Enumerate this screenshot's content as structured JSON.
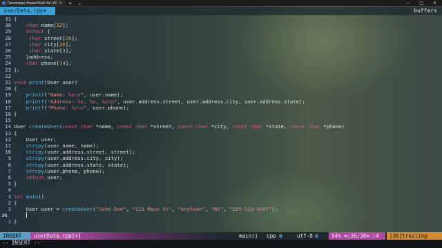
{
  "window": {
    "tab_title": "Developer PowerShell for VS",
    "new_tab": "+",
    "dropdown": "⌄",
    "controls": [
      "—",
      "□",
      "✕"
    ]
  },
  "tabline": {
    "active_buffer": "userData.cpp",
    "modified_marker": "+",
    "right_label": "buffers"
  },
  "editor": {
    "current_line": "36",
    "lines": [
      {
        "n": "31",
        "tokens": [
          [
            "id",
            "{"
          ]
        ]
      },
      {
        "n": "30",
        "tokens": [
          [
            "id",
            "    "
          ],
          [
            "ty",
            "char"
          ],
          [
            "id",
            " name["
          ],
          [
            "num",
            "32"
          ],
          [
            "id",
            "];"
          ]
        ]
      },
      {
        "n": "29",
        "tokens": [
          [
            "id",
            "    "
          ],
          [
            "ty",
            "struct"
          ],
          [
            "id",
            " {"
          ]
        ]
      },
      {
        "n": "28",
        "tokens": [
          [
            "id",
            "     "
          ],
          [
            "ty",
            "char"
          ],
          [
            "id",
            " street["
          ],
          [
            "num",
            "20"
          ],
          [
            "id",
            "];"
          ]
        ]
      },
      {
        "n": "27",
        "tokens": [
          [
            "id",
            "     "
          ],
          [
            "ty",
            "char"
          ],
          [
            "id",
            " city["
          ],
          [
            "num",
            "20"
          ],
          [
            "id",
            "];"
          ]
        ]
      },
      {
        "n": "26",
        "tokens": [
          [
            "id",
            "     "
          ],
          [
            "ty",
            "char"
          ],
          [
            "id",
            " state["
          ],
          [
            "num",
            "3"
          ],
          [
            "id",
            "];"
          ]
        ]
      },
      {
        "n": "25",
        "tokens": [
          [
            "id",
            "    }address;"
          ]
        ]
      },
      {
        "n": "24",
        "tokens": [
          [
            "id",
            "    "
          ],
          [
            "ty",
            "char"
          ],
          [
            "id",
            " phone["
          ],
          [
            "num",
            "14"
          ],
          [
            "id",
            "];"
          ]
        ]
      },
      {
        "n": "23",
        "tokens": [
          [
            "id",
            "};"
          ]
        ]
      },
      {
        "n": "22",
        "tokens": []
      },
      {
        "n": "21",
        "tokens": [
          [
            "ty",
            "void"
          ],
          [
            "id",
            " "
          ],
          [
            "fn",
            "print"
          ],
          [
            "id",
            "(User user)"
          ]
        ]
      },
      {
        "n": "20",
        "tokens": [
          [
            "id",
            "{"
          ]
        ]
      },
      {
        "n": "19",
        "tokens": [
          [
            "id",
            "    "
          ],
          [
            "fn",
            "printf"
          ],
          [
            "id",
            "("
          ],
          [
            "str",
            "\"Name: "
          ],
          [
            "kw",
            "%s\\n"
          ],
          [
            "str",
            "\""
          ],
          [
            "id",
            ", user.name);"
          ]
        ]
      },
      {
        "n": "18",
        "tokens": [
          [
            "id",
            "    "
          ],
          [
            "fn",
            "printf"
          ],
          [
            "id",
            "("
          ],
          [
            "str",
            "\"Address: "
          ],
          [
            "kw",
            "%s"
          ],
          [
            "str",
            ", "
          ],
          [
            "kw",
            "%s"
          ],
          [
            "str",
            ", "
          ],
          [
            "kw",
            "%s\\n"
          ],
          [
            "str",
            "\""
          ],
          [
            "id",
            ", user.address.street, user.address.city, user.address.state);"
          ]
        ]
      },
      {
        "n": "17",
        "tokens": [
          [
            "id",
            "    "
          ],
          [
            "fn",
            "printf"
          ],
          [
            "id",
            "("
          ],
          [
            "str",
            "\"Phone: "
          ],
          [
            "kw",
            "%s\\n"
          ],
          [
            "str",
            "\""
          ],
          [
            "id",
            ", user.phone);"
          ]
        ]
      },
      {
        "n": "16",
        "tokens": [
          [
            "id",
            "}"
          ]
        ]
      },
      {
        "n": "15",
        "tokens": []
      },
      {
        "n": "14",
        "tokens": [
          [
            "id",
            "User "
          ],
          [
            "fn",
            "createUser"
          ],
          [
            "id",
            "("
          ],
          [
            "ty",
            "const char"
          ],
          [
            "id",
            " *name, "
          ],
          [
            "ty",
            "const char"
          ],
          [
            "id",
            " *street, "
          ],
          [
            "ty",
            "const char"
          ],
          [
            "id",
            " *city, "
          ],
          [
            "ty",
            "const char"
          ],
          [
            "id",
            " *state, "
          ],
          [
            "ty",
            "const char"
          ],
          [
            "id",
            " *phone)"
          ]
        ]
      },
      {
        "n": "13",
        "tokens": [
          [
            "id",
            "{"
          ]
        ]
      },
      {
        "n": "12",
        "tokens": [
          [
            "id",
            "    User user;"
          ]
        ]
      },
      {
        "n": "11",
        "tokens": [
          [
            "id",
            "    "
          ],
          [
            "fn",
            "strcpy"
          ],
          [
            "id",
            "(user.name, name);"
          ]
        ]
      },
      {
        "n": "10",
        "tokens": [
          [
            "id",
            "    "
          ],
          [
            "fn",
            "strcpy"
          ],
          [
            "id",
            "(user.address.street, street);"
          ]
        ]
      },
      {
        "n": "9",
        "tokens": [
          [
            "id",
            "    "
          ],
          [
            "fn",
            "strcpy"
          ],
          [
            "id",
            "(user.address.city, city);"
          ]
        ]
      },
      {
        "n": "8",
        "tokens": [
          [
            "id",
            "    "
          ],
          [
            "fn",
            "strcpy"
          ],
          [
            "id",
            "(user.address.state, state);"
          ]
        ]
      },
      {
        "n": "7",
        "tokens": [
          [
            "id",
            "    "
          ],
          [
            "fn",
            "strcpy"
          ],
          [
            "id",
            "(user.phone, phone);"
          ]
        ]
      },
      {
        "n": "6",
        "tokens": [
          [
            "id",
            "    "
          ],
          [
            "kw",
            "return"
          ],
          [
            "id",
            " user;"
          ]
        ]
      },
      {
        "n": "5",
        "tokens": [
          [
            "id",
            "}"
          ]
        ]
      },
      {
        "n": "4",
        "tokens": []
      },
      {
        "n": "3",
        "tokens": [
          [
            "ty",
            "int"
          ],
          [
            "id",
            " "
          ],
          [
            "fn",
            "main"
          ],
          [
            "id",
            "()"
          ]
        ]
      },
      {
        "n": "2",
        "tokens": [
          [
            "id",
            "{"
          ]
        ]
      },
      {
        "n": "1",
        "tokens": [
          [
            "id",
            "    User user = "
          ],
          [
            "fn",
            "createUser"
          ],
          [
            "id",
            "("
          ],
          [
            "str",
            "\"John Doe\""
          ],
          [
            "id",
            ", "
          ],
          [
            "str",
            "\"123 Main St\""
          ],
          [
            "id",
            ", "
          ],
          [
            "str",
            "\"Anytown\""
          ],
          [
            "id",
            ", "
          ],
          [
            "str",
            "\"NY\""
          ],
          [
            "id",
            ", "
          ],
          [
            "str",
            "\"555-123-4567\""
          ],
          [
            "id",
            ");"
          ]
        ]
      },
      {
        "n": "36",
        "tokens": [
          [
            "id",
            "    "
          ]
        ],
        "cursor": true
      },
      {
        "n": "1",
        "tokens": [
          [
            "id",
            "}"
          ]
        ]
      }
    ]
  },
  "statusline": {
    "mode": "INSERT",
    "filename": "userData.cpp[+]",
    "function": "main()",
    "filetype": "cpp",
    "filetype_icon": "⚙",
    "encoding": "utf-8",
    "encoding_icon": "⚙",
    "position": "94% ≡:36/38≡ :4",
    "trailing": "[36]trailing"
  },
  "cmdline": {
    "text": "-- INSERT --"
  }
}
